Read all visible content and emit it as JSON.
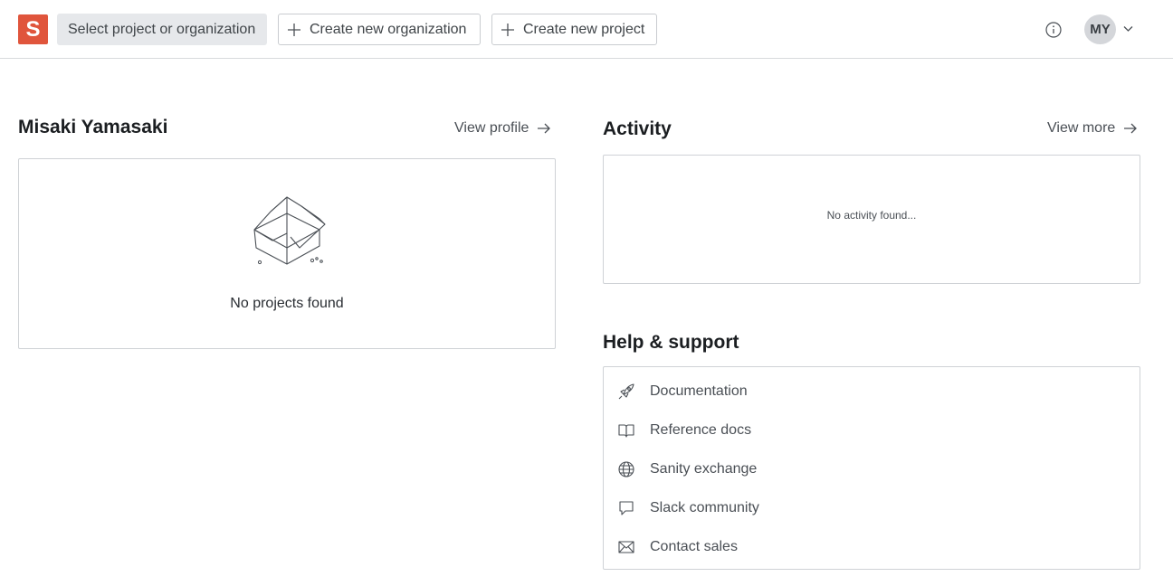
{
  "header": {
    "logo_letter": "S",
    "select_label": "Select project or organization",
    "create_org_label": "Create new organization",
    "create_project_label": "Create new project",
    "avatar_initials": "MY"
  },
  "profile": {
    "name": "Misaki Yamasaki",
    "view_profile_label": "View profile",
    "empty_text": "No projects found"
  },
  "activity": {
    "title": "Activity",
    "view_more_label": "View more",
    "empty_text": "No activity found..."
  },
  "help": {
    "title": "Help & support",
    "items": [
      {
        "label": "Documentation",
        "icon": "rocket-icon"
      },
      {
        "label": "Reference docs",
        "icon": "book-icon"
      },
      {
        "label": "Sanity exchange",
        "icon": "globe-icon"
      },
      {
        "label": "Slack community",
        "icon": "chat-icon"
      },
      {
        "label": "Contact sales",
        "icon": "envelope-icon"
      }
    ]
  },
  "colors": {
    "brand": "#e0553c",
    "border": "#cfd2d6",
    "select_bg": "#e6e8eb"
  }
}
